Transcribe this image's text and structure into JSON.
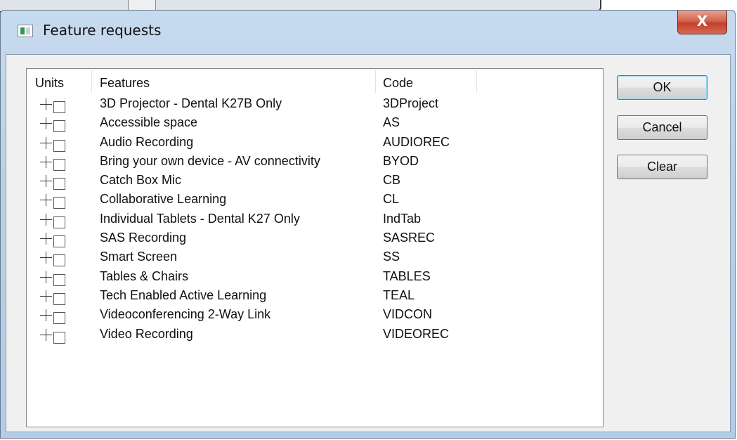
{
  "window": {
    "title": "Feature requests",
    "close_label": "X"
  },
  "list": {
    "columns": [
      "Units",
      "Features",
      "Code"
    ],
    "rows": [
      {
        "feature": "3D Projector - Dental K27B Only",
        "code": "3DProject"
      },
      {
        "feature": "Accessible space",
        "code": "AS"
      },
      {
        "feature": "Audio Recording",
        "code": "AUDIOREC"
      },
      {
        "feature": "Bring your own device - AV connectivity",
        "code": "BYOD"
      },
      {
        "feature": "Catch Box Mic",
        "code": "CB"
      },
      {
        "feature": "Collaborative Learning",
        "code": "CL"
      },
      {
        "feature": "Individual Tablets - Dental K27 Only",
        "code": "IndTab"
      },
      {
        "feature": "SAS Recording",
        "code": "SASREC"
      },
      {
        "feature": "Smart Screen",
        "code": "SS"
      },
      {
        "feature": "Tables & Chairs",
        "code": "TABLES"
      },
      {
        "feature": "Tech Enabled Active Learning",
        "code": "TEAL"
      },
      {
        "feature": "Videoconferencing 2-Way Link",
        "code": "VIDCON"
      },
      {
        "feature": "Video Recording",
        "code": "VIDEOREC"
      }
    ]
  },
  "buttons": {
    "ok": "OK",
    "cancel": "Cancel",
    "clear": "Clear"
  },
  "colors": {
    "title_bar": "#b9d0e8",
    "close_button": "#c2412a",
    "client_bg": "#f0f0f0"
  }
}
